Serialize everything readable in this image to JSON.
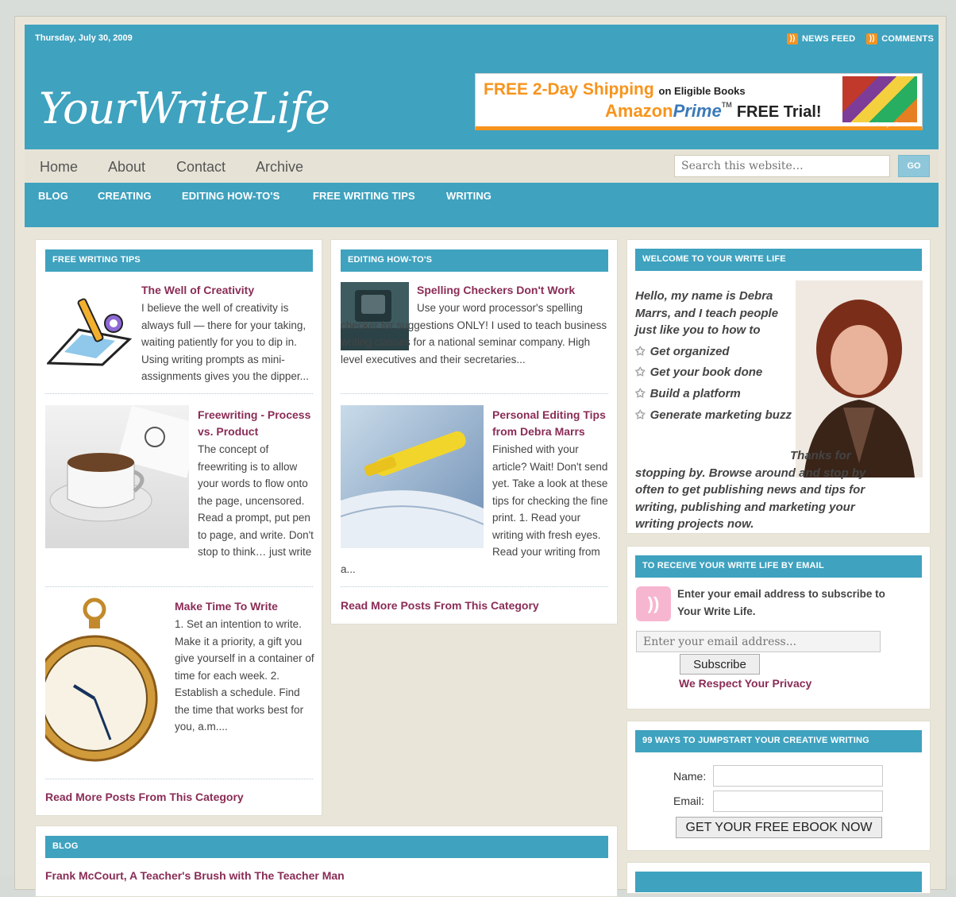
{
  "header": {
    "date": "Thursday, July 30, 2009",
    "feeds": [
      "NEWS FEED",
      "COMMENTS"
    ],
    "logo_text": "YourWriteLife"
  },
  "ad": {
    "line1_big": "FREE 2-Day Shipping",
    "line1_small": "on Eligible Books",
    "line2_brand": "Amazon",
    "line2_prime": "Prime",
    "line2_tm": "TM",
    "line2_rest": "FREE Trial!",
    "privacy": "Privacy Information"
  },
  "nav_primary": [
    "Home",
    "About",
    "Contact",
    "Archive"
  ],
  "search": {
    "placeholder": "Search this website…",
    "go": "GO"
  },
  "nav_categories": [
    "BLOG",
    "CREATING",
    "EDITING HOW-TO'S",
    "FREE WRITING TIPS",
    "WRITING"
  ],
  "col1": {
    "heading": "FREE WRITING TIPS",
    "posts": [
      {
        "title": "The Well of Creativity",
        "excerpt": "I believe the well of creativity is always full — there for your taking, waiting patiently for you to dip in. Using writing prompts as mini-assignments gives you the dipper..."
      },
      {
        "title": "Freewriting - Process vs. Product",
        "excerpt": "The concept of freewriting is to allow your words to flow onto the page, uncensored. Read a prompt, put pen to page, and write. Don't stop to think… just write what..."
      },
      {
        "title": "Make Time To Write",
        "excerpt": "1. Set an intention to write. Make it a priority, a gift you give yourself in a container of time for each week. 2. Establish a schedule. Find the time that works best for you, a.m...."
      }
    ],
    "more": "Read More Posts From This Category"
  },
  "col2": {
    "heading": "EDITING HOW-TO'S",
    "posts": [
      {
        "title": "Spelling Checkers Don't Work",
        "excerpt": "Use your word processor's spelling checker for suggestions ONLY! I used to teach business writing classes for a national seminar company. High level executives and their secretaries..."
      },
      {
        "title": "Personal Editing Tips from Debra Marrs",
        "excerpt": "Finished with your article? Wait! Don't send yet. Take a look at these tips for checking the fine print. 1. Read your writing with fresh eyes. Read your writing from a..."
      }
    ],
    "more": "Read More Posts From This Category"
  },
  "blog": {
    "heading": "BLOG",
    "first_title": "Frank McCourt, A Teacher's Brush with The Teacher Man"
  },
  "sidebar": {
    "welcome_heading": "WELCOME TO YOUR WRITE LIFE",
    "welcome_intro": "Hello, my name is Debra Marrs, and I teach people just like you to how to",
    "welcome_items": [
      "Get organized",
      "Get your book done",
      "Build a platform",
      "Generate marketing buzz"
    ],
    "welcome_outro": "Thanks for stopping by. Browse around and stop by often to get publishing news and tips for writing, publishing and marketing your writing projects now.",
    "email_heading": "TO RECEIVE YOUR WRITE LIFE BY EMAIL",
    "email_text": "Enter your email address to subscribe to Your Write Life.",
    "email_placeholder": "Enter your email address...",
    "subscribe": "Subscribe",
    "privacy": "We Respect Your Privacy",
    "ebook_heading": "99 WAYS TO JUMPSTART YOUR CREATIVE WRITING",
    "name_label": "Name:",
    "email_label": "Email:",
    "ebook_button": "GET YOUR FREE EBOOK NOW"
  },
  "colors": {
    "accent": "#3fa2bf",
    "post_title": "#8a2c56",
    "background": "#e9e6d9",
    "rss": "#f29322"
  },
  "icons": [
    "rss-icon",
    "star-icon",
    "rss-email-icon"
  ]
}
